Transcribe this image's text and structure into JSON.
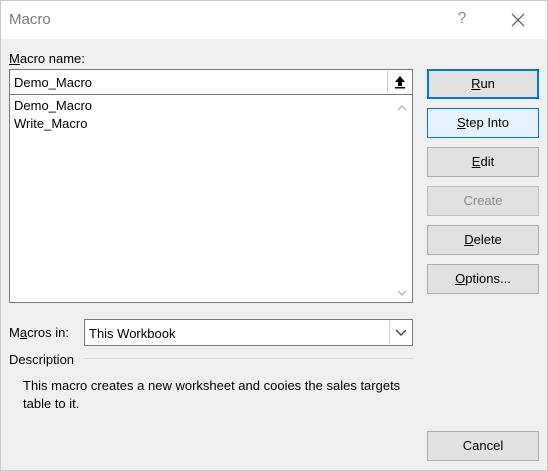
{
  "dialog": {
    "title": "Macro",
    "help_glyph": "?"
  },
  "macro_name": {
    "label_first": "M",
    "label_rest": "acro name:",
    "value": "Demo_Macro"
  },
  "macro_list": {
    "items": [
      "Demo_Macro",
      "Write_Macro"
    ]
  },
  "buttons": {
    "run": {
      "u": "R",
      "rest": "un"
    },
    "step_into": {
      "u": "S",
      "rest": "tep Into"
    },
    "edit": {
      "u": "E",
      "rest": "dit"
    },
    "create": "Create",
    "delete": {
      "u": "D",
      "rest": "elete"
    },
    "options": {
      "u": "O",
      "rest": "ptions..."
    },
    "cancel": "Cancel"
  },
  "macros_in": {
    "label_first": "M",
    "label_u": "a",
    "label_rest": "cros in:",
    "value": "This Workbook"
  },
  "description": {
    "label": "Description",
    "text": "This macro creates a new worksheet and cooies the sales targets table to it."
  },
  "colors": {
    "accent": "#0078d7",
    "dialog_bg": "#f0f0f0"
  }
}
